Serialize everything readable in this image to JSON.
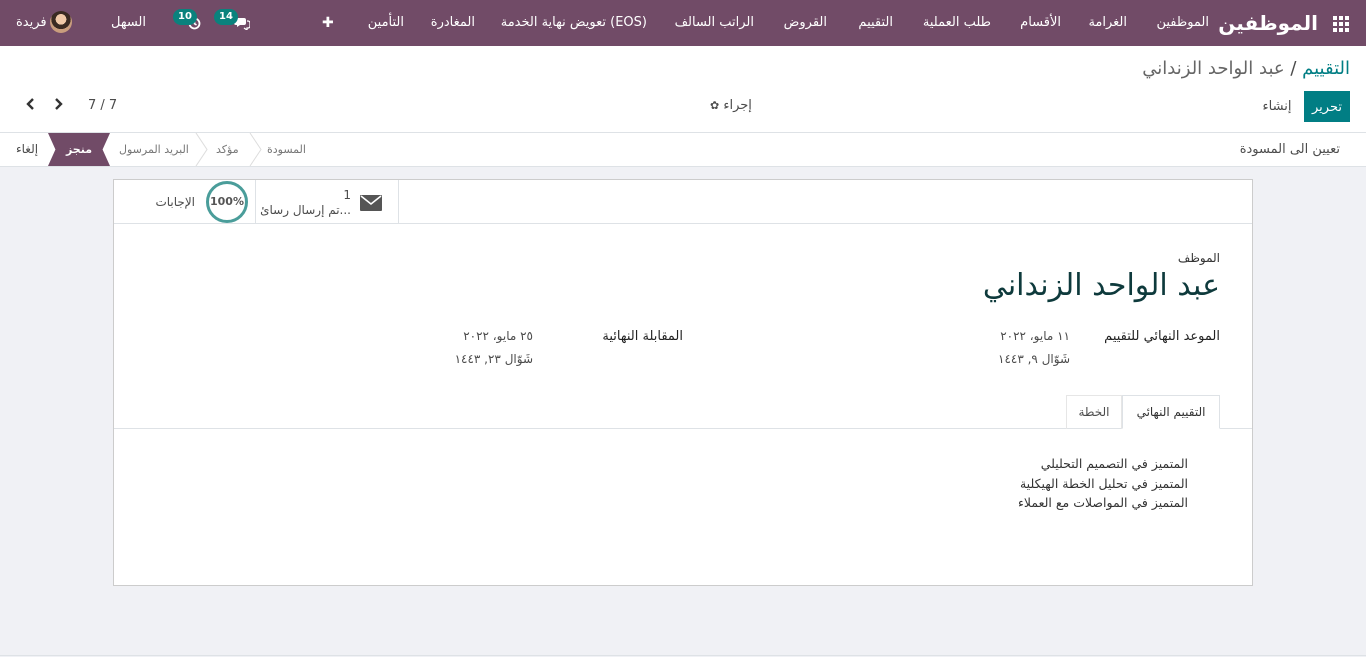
{
  "navbar": {
    "app_title": "الموظفين",
    "apps_icon": "grid-icon",
    "menu": [
      "الموظفين",
      "الغرامة",
      "الأقسام",
      "طلب العملية",
      "التقييم",
      "القروض",
      "الراتب السالف",
      "تعويض نهاية الخدمة (EOS)",
      "المغادرة",
      "التأمين"
    ],
    "add_symbol": "✚",
    "messages_count": "14",
    "activities_count": "10",
    "company": "السهل",
    "user": "فريدة"
  },
  "breadcrumb": {
    "parent": "التقييم",
    "separator": " / ",
    "current": "عبد الواحد الزنداني"
  },
  "controls": {
    "edit": "تحرير",
    "create": "إنشاء",
    "action": "إجراء",
    "pager": "7 / 7",
    "prev": "‹",
    "next": "›"
  },
  "statusbar": {
    "reset_button": "تعيين الى المسودة",
    "stages": [
      "المسودة",
      "مؤكد",
      "البريد المرسول",
      "منجز"
    ],
    "active_stage": "منجز",
    "cancel_button": "إلغاء"
  },
  "stat_buttons": {
    "sent_count": "1",
    "sent_label": "تم إرسال رسائ...",
    "answers_percent": "100%",
    "answers_label": "الإجابات"
  },
  "form": {
    "employee_label": "الموظف",
    "employee_name": "عبد الواحد الزنداني",
    "deadline_label": "الموعد النهائي للتقييم",
    "deadline_value": "١١ مايو، ٢٠٢٢",
    "deadline_hijri": "شَوّال ٩, ١٤٤٣",
    "final_interview_label": "المقابلة النهائية",
    "final_interview_value": "٢٥ مايو، ٢٠٢٢",
    "final_interview_hijri": "شَوّال ٢٣, ١٤٤٣"
  },
  "tabs": {
    "final_evaluation": "التقييم النهائي",
    "plan": "الخطة"
  },
  "notes": [
    "المتميز في التصميم التحليلي",
    "المتميز في تحليل الخطة الهيكلية",
    "المتميز في المواصلات مع العملاء"
  ],
  "colors": {
    "brand": "#714b67",
    "accent": "#017e84",
    "badge": "#0a827d"
  }
}
